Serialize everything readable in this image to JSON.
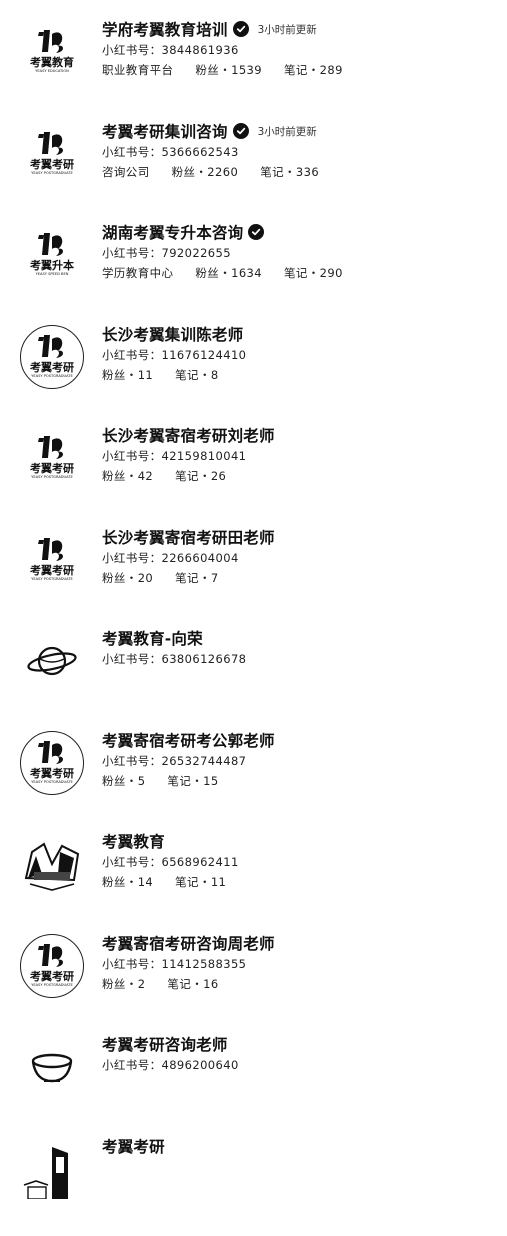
{
  "results": [
    {
      "name": "学府考翼教育培训",
      "verified": true,
      "updated": "3小时前更新",
      "id_label": "小红书号：",
      "id": "3844861936",
      "meta": [
        "职业教育平台",
        "粉丝・1539",
        "笔记・289"
      ],
      "avatar": {
        "icon": "brand-logo-icon",
        "caption": "考翼教育",
        "sub": "YEASY EDUCATION"
      }
    },
    {
      "name": "考翼考研集训咨询",
      "verified": true,
      "updated": "3小时前更新",
      "id_label": "小红书号：",
      "id": "5366662543",
      "meta": [
        "咨询公司",
        "粉丝・2260",
        "笔记・336"
      ],
      "avatar": {
        "icon": "brand-logo-icon",
        "caption": "考翼考研",
        "sub": "YEASY POSTGRADUATE"
      }
    },
    {
      "name": "湖南考翼专升本咨询",
      "verified": true,
      "updated": "",
      "id_label": "小红书号：",
      "id": "792022655",
      "meta": [
        "学历教育中心",
        "粉丝・1634",
        "笔记・290"
      ],
      "avatar": {
        "icon": "brand-logo-icon",
        "caption": "考翼升本",
        "sub": "YEASY SPEED BEN"
      }
    },
    {
      "name": "长沙考翼集训陈老师",
      "verified": false,
      "updated": "",
      "id_label": "小红书号：",
      "id": "11676124410",
      "meta": [
        "粉丝・11",
        "笔记・8"
      ],
      "avatar": {
        "icon": "brand-logo-ring-icon",
        "caption": "考翼考研",
        "sub": "YEASY POSTGRADUATE"
      }
    },
    {
      "name": "长沙考翼寄宿考研刘老师",
      "verified": false,
      "updated": "",
      "id_label": "小红书号：",
      "id": "42159810041",
      "meta": [
        "粉丝・42",
        "笔记・26"
      ],
      "avatar": {
        "icon": "brand-logo-icon",
        "caption": "考翼考研",
        "sub": "YEASY POSTGRADUATE"
      }
    },
    {
      "name": "长沙考翼寄宿考研田老师",
      "verified": false,
      "updated": "",
      "id_label": "小红书号：",
      "id": "2266604004",
      "meta": [
        "粉丝・20",
        "笔记・7"
      ],
      "avatar": {
        "icon": "brand-logo-icon",
        "caption": "考翼考研",
        "sub": "YEASY POSTGRADUATE"
      }
    },
    {
      "name": "考翼教育-向荣",
      "verified": false,
      "updated": "",
      "id_label": "小红书号：",
      "id": "63806126678",
      "meta": [],
      "avatar": {
        "icon": "planet-icon",
        "caption": "",
        "sub": ""
      }
    },
    {
      "name": "考翼寄宿考研考公郭老师",
      "verified": false,
      "updated": "",
      "id_label": "小红书号：",
      "id": "26532744487",
      "meta": [
        "粉丝・5",
        "笔记・15"
      ],
      "avatar": {
        "icon": "brand-logo-ring-icon",
        "caption": "考翼考研",
        "sub": "YEASY POSTGRADUATE"
      }
    },
    {
      "name": "考翼教育",
      "verified": false,
      "updated": "",
      "id_label": "小红书号：",
      "id": "6568962411",
      "meta": [
        "粉丝・14",
        "笔记・11"
      ],
      "avatar": {
        "icon": "campus-photo-icon",
        "caption": "",
        "sub": ""
      }
    },
    {
      "name": "考翼寄宿考研咨询周老师",
      "verified": false,
      "updated": "",
      "id_label": "小红书号：",
      "id": "11412588355",
      "meta": [
        "粉丝・2",
        "笔记・16"
      ],
      "avatar": {
        "icon": "brand-logo-ring-icon",
        "caption": "考翼考研",
        "sub": "YEASY POSTGRADUATE"
      }
    },
    {
      "name": "考翼考研咨询老师",
      "verified": false,
      "updated": "",
      "id_label": "小红书号：",
      "id": "4896200640",
      "meta": [],
      "avatar": {
        "icon": "bowl-icon",
        "caption": "",
        "sub": ""
      }
    },
    {
      "name": "考翼考研",
      "verified": false,
      "updated": "",
      "id_label": "",
      "id": "",
      "meta": [],
      "avatar": {
        "icon": "building-photo-icon",
        "caption": "",
        "sub": ""
      }
    }
  ]
}
